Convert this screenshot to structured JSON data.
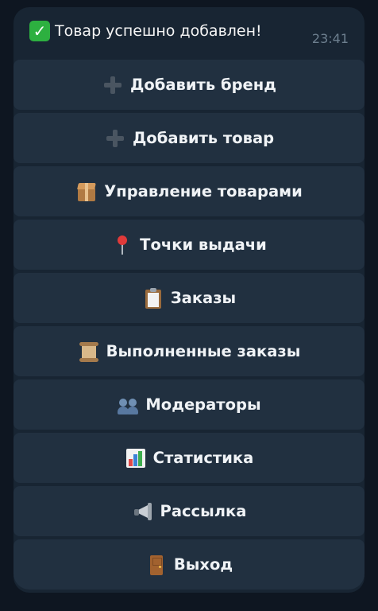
{
  "message": {
    "text": "Товар успешно добавлен!",
    "time": "23:41"
  },
  "keyboard": [
    {
      "label": "Добавить бренд",
      "icon": "plus-icon"
    },
    {
      "label": "Добавить товар",
      "icon": "plus-icon"
    },
    {
      "label": "Управление товарами",
      "icon": "package-icon"
    },
    {
      "label": "Точки выдачи",
      "icon": "pushpin-icon"
    },
    {
      "label": "Заказы",
      "icon": "clipboard-icon"
    },
    {
      "label": "Выполненные заказы",
      "icon": "scroll-icon"
    },
    {
      "label": "Модераторы",
      "icon": "people-icon"
    },
    {
      "label": "Статистика",
      "icon": "bar-chart-icon"
    },
    {
      "label": "Рассылка",
      "icon": "megaphone-icon"
    },
    {
      "label": "Выход",
      "icon": "door-icon"
    }
  ],
  "colors": {
    "background": "#0e1621",
    "bubble": "#182533",
    "button": "#213040",
    "check": "#2db040"
  }
}
